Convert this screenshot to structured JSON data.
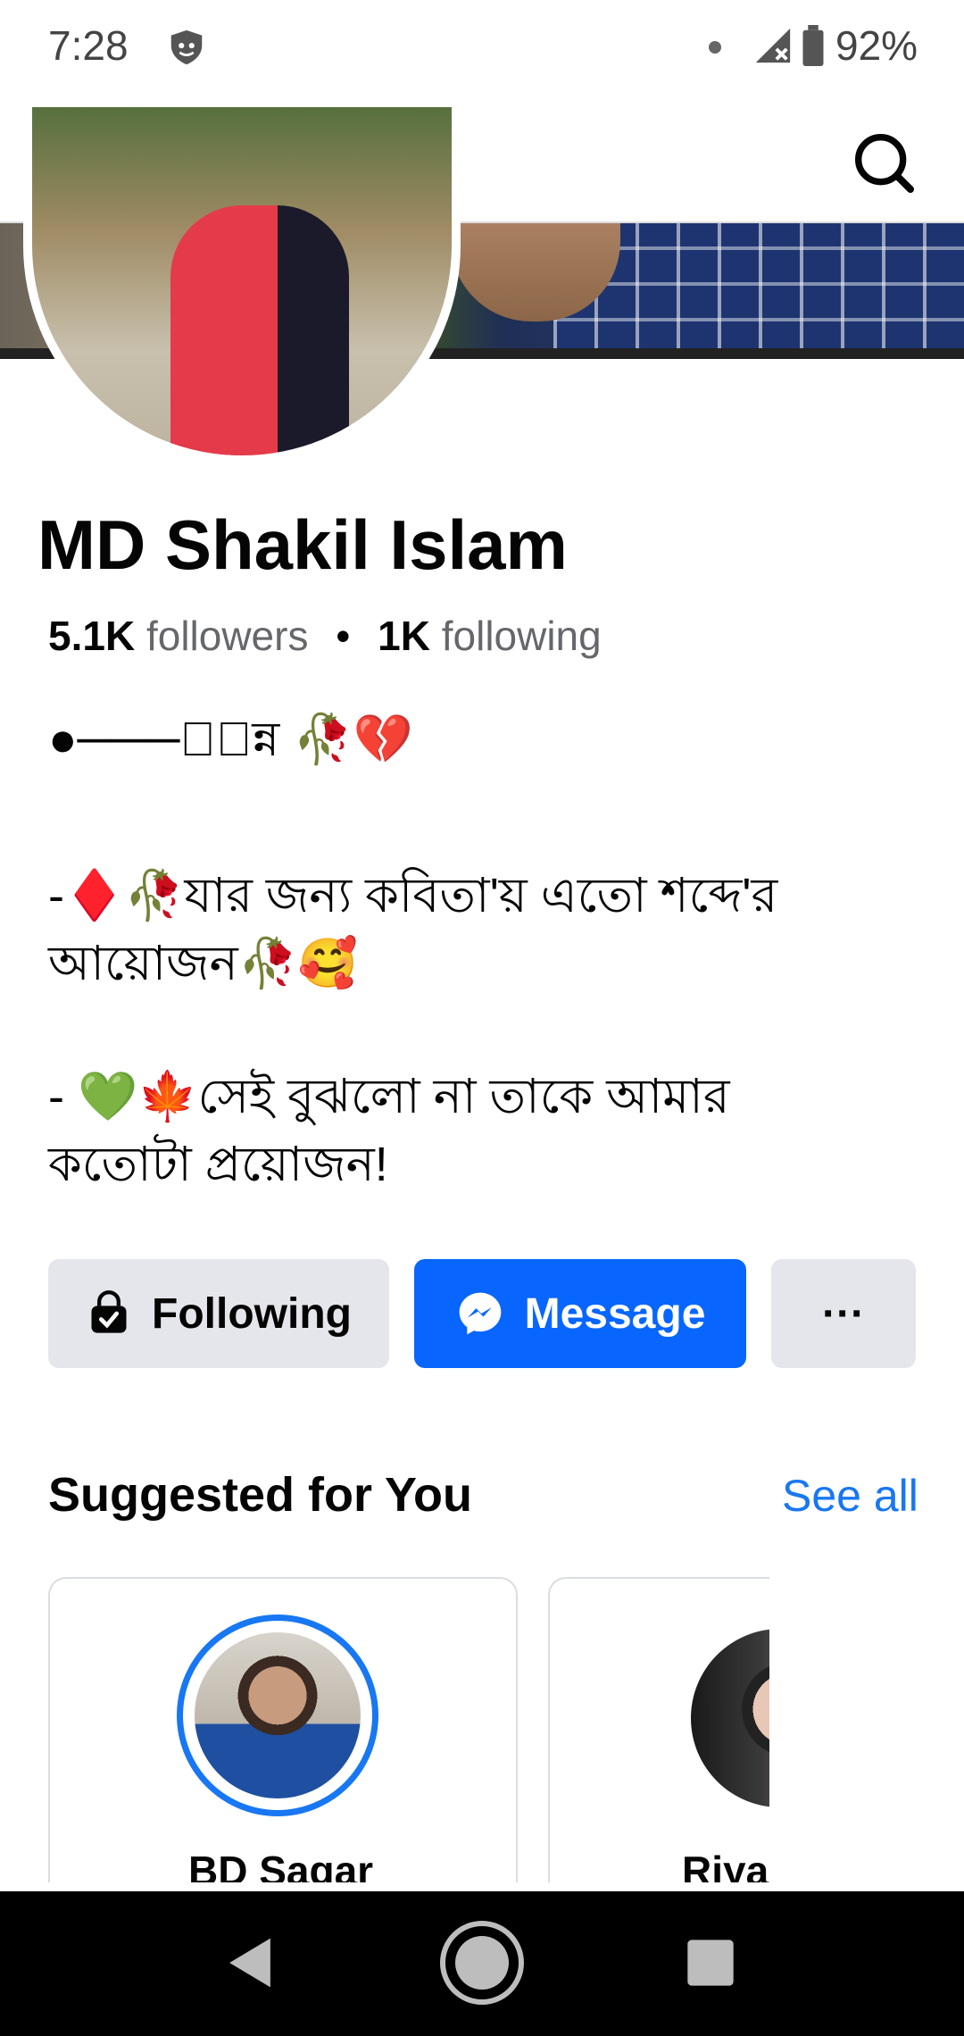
{
  "status_bar": {
    "time": "7:28",
    "battery": "92%"
  },
  "profile": {
    "name": "MD Shakil Islam",
    "followers_count": "5.1K",
    "followers_label": "followers",
    "following_count": "1K",
    "following_label": "following",
    "bio_line1": "●───ঁিন্ন 🥀💔",
    "bio_line2": "-♦️🥀যার জন্য কবিতা'য় এতো শব্দে'র\nআয়োজন🥀🥰",
    "bio_line3": "- 💚🍁সেই বুঝলো না তাকে আমার\nকতোটা প্রয়োজন!"
  },
  "actions": {
    "following_label": "Following",
    "message_label": "Message",
    "more_label": "···"
  },
  "suggested": {
    "title": "Suggested for You",
    "see_all": "See all",
    "cards": [
      {
        "name": "BD Sagar"
      },
      {
        "name": "Riya"
      }
    ]
  },
  "colors": {
    "accent": "#0866ff",
    "link": "#1877f2",
    "button_gray": "#e4e6eb"
  },
  "icons": {
    "status": [
      "shield-icon",
      "signal-icon",
      "battery-icon"
    ],
    "appbar": [
      "back-arrow-icon",
      "search-icon"
    ],
    "buttons": [
      "following-check-icon",
      "messenger-icon",
      "more-icon"
    ],
    "nav": [
      "back-triangle-icon",
      "home-circle-icon",
      "recents-square-icon"
    ]
  }
}
